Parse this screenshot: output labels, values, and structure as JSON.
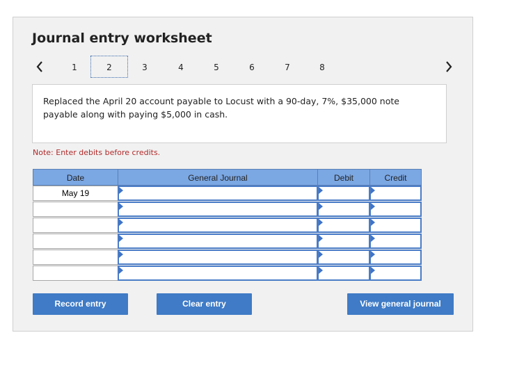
{
  "title": "Journal entry worksheet",
  "steps": [
    "1",
    "2",
    "3",
    "4",
    "5",
    "6",
    "7",
    "8"
  ],
  "active_step": "2",
  "description": "Replaced the April 20 account payable to Locust with a 90-day, 7%, $35,000 note payable along with paying $5,000 in cash.",
  "note": "Note: Enter debits before credits.",
  "table": {
    "headers": {
      "date": "Date",
      "journal": "General Journal",
      "debit": "Debit",
      "credit": "Credit"
    },
    "rows": [
      {
        "date": "May 19",
        "journal": "",
        "debit": "",
        "credit": ""
      },
      {
        "date": "",
        "journal": "",
        "debit": "",
        "credit": ""
      },
      {
        "date": "",
        "journal": "",
        "debit": "",
        "credit": ""
      },
      {
        "date": "",
        "journal": "",
        "debit": "",
        "credit": ""
      },
      {
        "date": "",
        "journal": "",
        "debit": "",
        "credit": ""
      },
      {
        "date": "",
        "journal": "",
        "debit": "",
        "credit": ""
      }
    ]
  },
  "buttons": {
    "record": "Record entry",
    "clear": "Clear entry",
    "view": "View general journal"
  },
  "colors": {
    "header_bg": "#7ba7e3",
    "button_bg": "#3f7bc6",
    "note_color": "#b02a2a"
  }
}
